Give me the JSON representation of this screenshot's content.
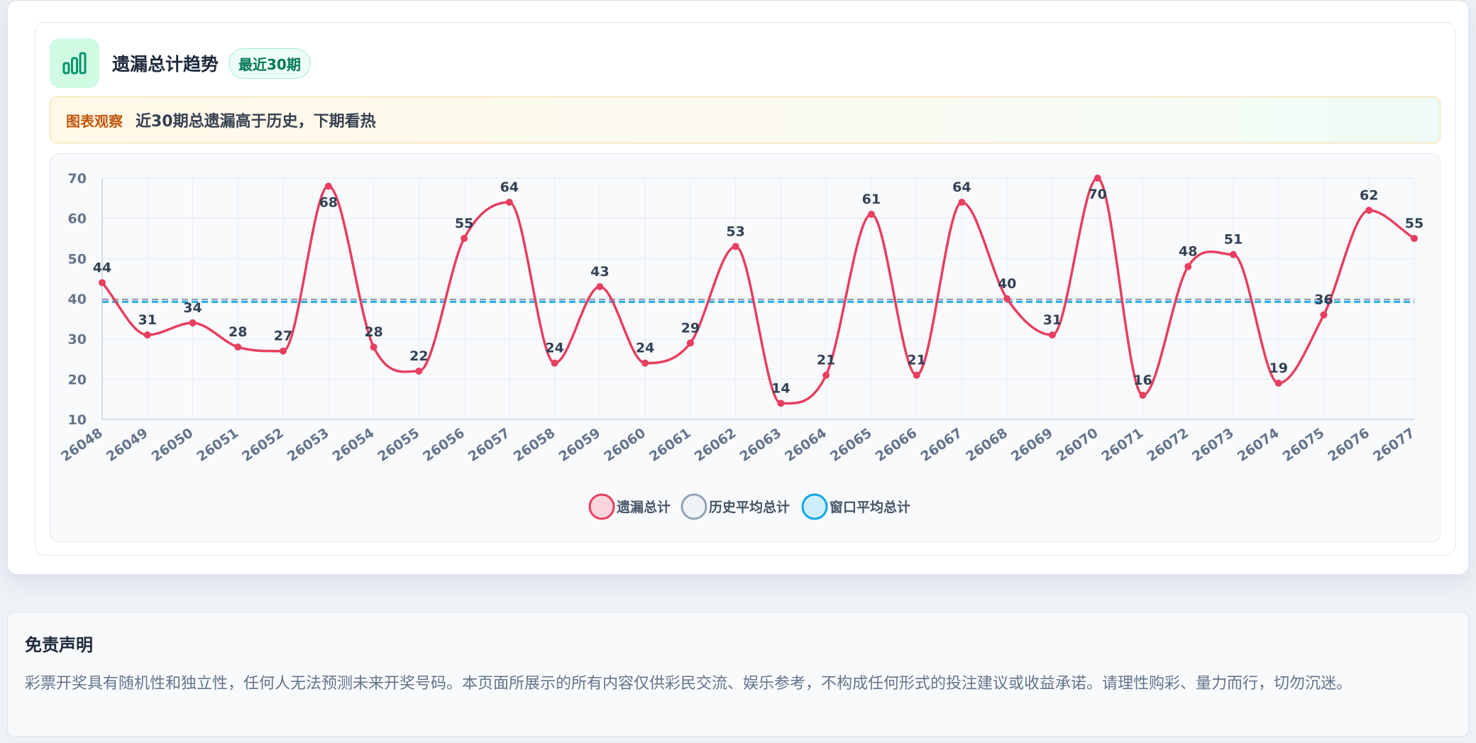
{
  "header": {
    "title": "遗漏总计趋势",
    "badge": "最近30期"
  },
  "observation": {
    "label": "图表观察",
    "text": "近30期总遗漏高于历史，下期看热"
  },
  "colors": {
    "series": "#e83e5f",
    "history_avg": "#94a3b8",
    "window_avg": "#0ea5e9",
    "accent": "#059669"
  },
  "chart_data": {
    "type": "line",
    "categories": [
      "26048",
      "26049",
      "26050",
      "26051",
      "26052",
      "26053",
      "26054",
      "26055",
      "26056",
      "26057",
      "26058",
      "26059",
      "26060",
      "26061",
      "26062",
      "26063",
      "26064",
      "26065",
      "26066",
      "26067",
      "26068",
      "26069",
      "26070",
      "26071",
      "26072",
      "26073",
      "26074",
      "26075",
      "26076",
      "26077"
    ],
    "series": [
      {
        "name": "遗漏总计",
        "values": [
          44,
          31,
          34,
          28,
          27,
          68,
          28,
          22,
          55,
          64,
          24,
          43,
          24,
          29,
          53,
          14,
          21,
          61,
          21,
          64,
          40,
          31,
          70,
          16,
          48,
          51,
          19,
          36,
          62,
          55
        ]
      },
      {
        "name": "历史平均总计",
        "values": [
          39.8,
          39.8,
          39.8,
          39.8,
          39.8,
          39.8,
          39.8,
          39.8,
          39.8,
          39.8,
          39.8,
          39.8,
          39.8,
          39.8,
          39.8,
          39.8,
          39.8,
          39.8,
          39.8,
          39.8,
          39.8,
          39.8,
          39.8,
          39.8,
          39.8,
          39.8,
          39.8,
          39.8,
          39.8,
          39.8
        ]
      },
      {
        "name": "窗口平均总计",
        "values": [
          39.2,
          39.2,
          39.2,
          39.2,
          39.2,
          39.2,
          39.2,
          39.2,
          39.2,
          39.2,
          39.2,
          39.2,
          39.2,
          39.2,
          39.2,
          39.2,
          39.2,
          39.2,
          39.2,
          39.2,
          39.2,
          39.2,
          39.2,
          39.2,
          39.2,
          39.2,
          39.2,
          39.2,
          39.2,
          39.2
        ]
      }
    ],
    "yticks": [
      10,
      20,
      30,
      40,
      50,
      60,
      70
    ],
    "ylim": [
      10,
      70
    ],
    "grid": true,
    "legend": "bottom-center"
  },
  "disclaimer": {
    "title": "免责声明",
    "text": "彩票开奖具有随机性和独立性，任何人无法预测未来开奖号码。本页面所展示的所有内容仅供彩民交流、娱乐参考，不构成任何形式的投注建议或收益承诺。请理性购彩、量力而行，切勿沉迷。"
  }
}
